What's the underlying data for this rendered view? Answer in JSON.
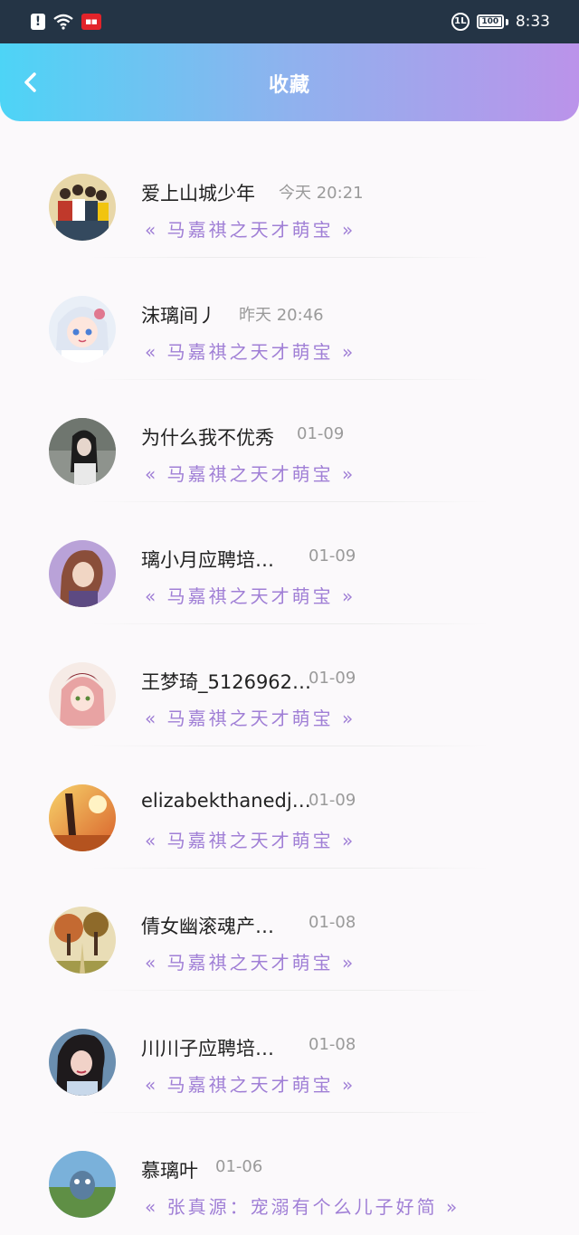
{
  "status_bar": {
    "alert_icon": "alert-icon",
    "wifi_icon": "wifi-icon",
    "app_icon": "app-notification-icon",
    "hd_label": "1L",
    "battery_level": "100",
    "time": "8:33"
  },
  "header": {
    "title": "收藏",
    "back_icon": "chevron-left-icon",
    "gradient_start": "#4dd4f6",
    "gradient_end": "#bb93ea"
  },
  "items": [
    {
      "name": "爱上山城少年",
      "time": "今天 20:21",
      "quote": "« 马嘉祺之天才萌宝 »"
    },
    {
      "name": "沫璃间丿",
      "time": "昨天 20:46",
      "quote": "« 马嘉祺之天才萌宝 »"
    },
    {
      "name": "为什么我不优秀",
      "time": "01-09",
      "quote": "« 马嘉祺之天才萌宝 »"
    },
    {
      "name": "璃小月应聘培…",
      "time": "01-09",
      "quote": "« 马嘉祺之天才萌宝 »"
    },
    {
      "name": "王梦琦_5126962…",
      "time": "01-09",
      "quote": "« 马嘉祺之天才萌宝 »"
    },
    {
      "name": "elizabekthanedj…",
      "time": "01-09",
      "quote": "« 马嘉祺之天才萌宝 »"
    },
    {
      "name": "倩女幽滚魂产…",
      "time": "01-08",
      "quote": "« 马嘉祺之天才萌宝 »"
    },
    {
      "name": "川川子应聘培…",
      "time": "01-08",
      "quote": "« 马嘉祺之天才萌宝 »"
    },
    {
      "name": "慕璃叶",
      "time": "01-06",
      "quote": "« 张真源：宠溺有个么儿子好简 »"
    }
  ],
  "colors": {
    "quote": "#a07fd6",
    "time": "#9a9a9a",
    "name": "#222222"
  }
}
